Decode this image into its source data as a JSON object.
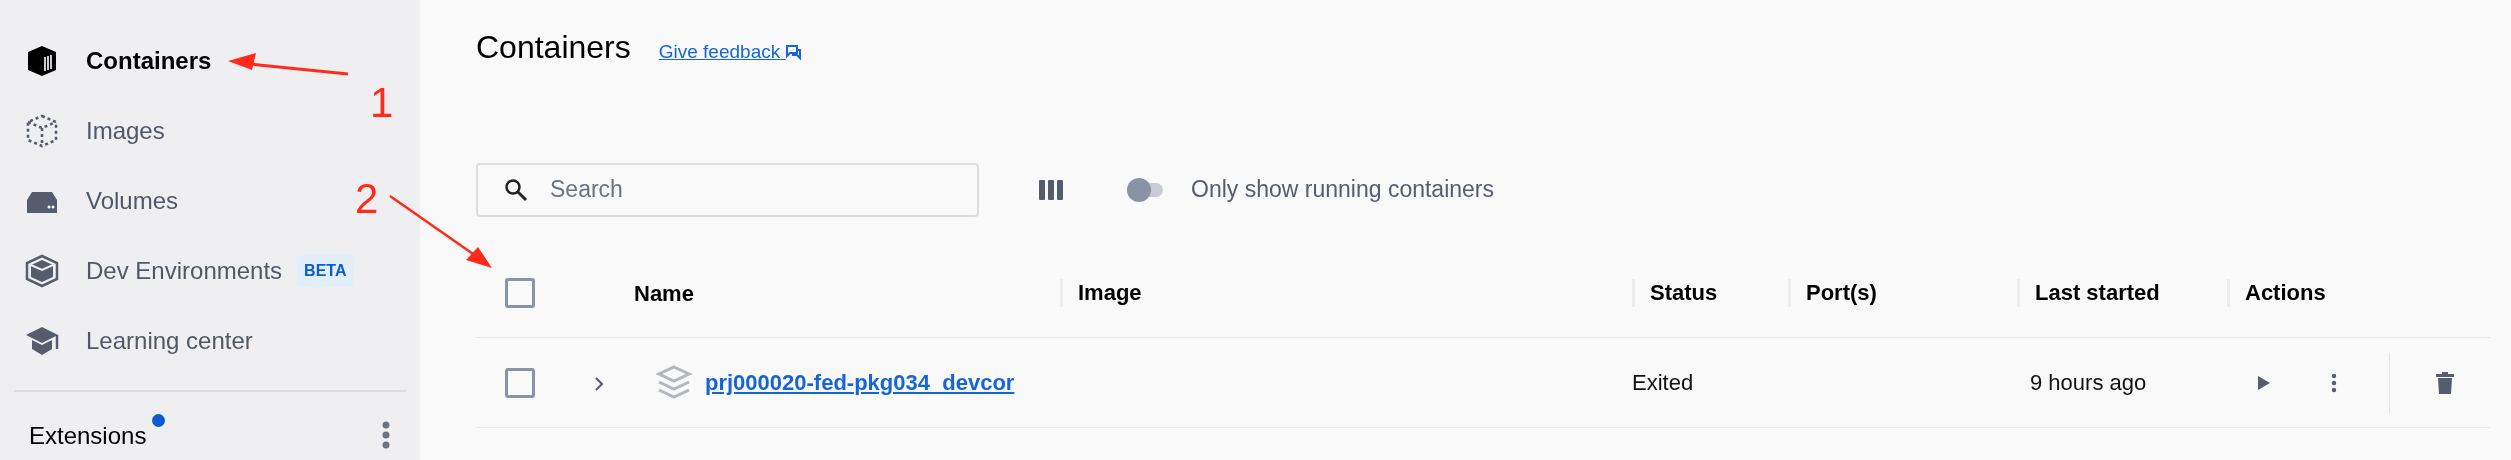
{
  "sidebar": {
    "items": [
      {
        "label": "Containers",
        "selected": true
      },
      {
        "label": "Images",
        "selected": false
      },
      {
        "label": "Volumes",
        "selected": false
      },
      {
        "label": "Dev Environments",
        "selected": false,
        "badge": "BETA"
      },
      {
        "label": "Learning center",
        "selected": false
      }
    ],
    "extensions": {
      "label": "Extensions",
      "notification": true
    }
  },
  "page": {
    "title": "Containers",
    "feedback_link": "Give feedback"
  },
  "search": {
    "placeholder": "Search"
  },
  "running_only": {
    "label": "Only show running containers",
    "on": false
  },
  "table": {
    "select_all": {
      "checked": false
    },
    "columns": [
      "Name",
      "Image",
      "Status",
      "Port(s)",
      "Last started",
      "Actions"
    ],
    "rows": [
      {
        "checked": false,
        "expanded": false,
        "name": "prj000020-fed-pkg034_devcor",
        "status": "Exited",
        "last_started": "9 hours ago"
      }
    ]
  },
  "annotations": [
    {
      "label": "1"
    },
    {
      "label": "2"
    }
  ]
}
